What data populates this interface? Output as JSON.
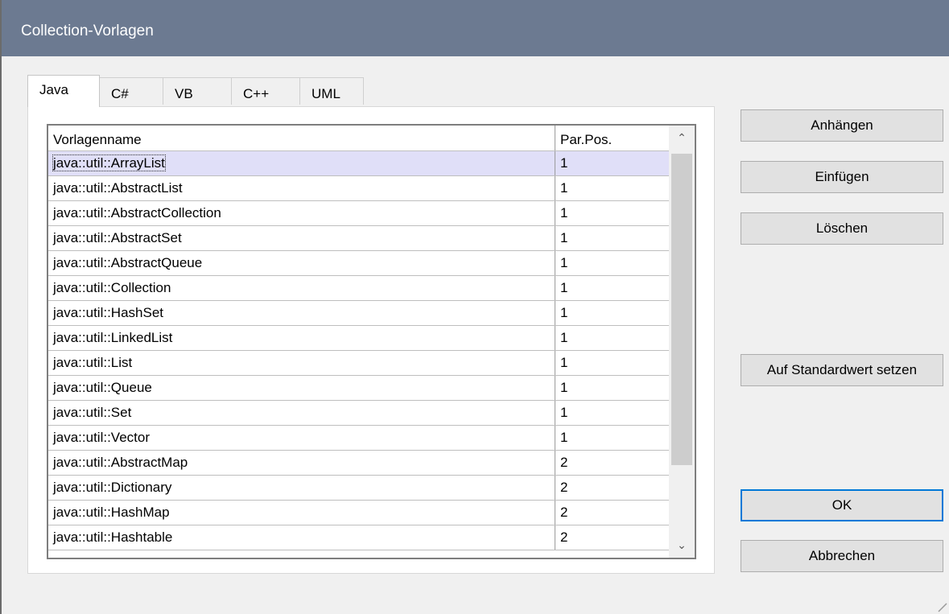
{
  "window": {
    "title": "Collection-Vorlagen"
  },
  "tabs": [
    {
      "label": "Java",
      "active": true
    },
    {
      "label": "C#",
      "active": false
    },
    {
      "label": "VB",
      "active": false
    },
    {
      "label": "C++",
      "active": false
    },
    {
      "label": "UML",
      "active": false
    }
  ],
  "table": {
    "columns": [
      "Vorlagenname",
      "Par.Pos."
    ],
    "rows": [
      {
        "name": "java::util::ArrayList",
        "pos": "1",
        "selected": true
      },
      {
        "name": "java::util::AbstractList",
        "pos": "1"
      },
      {
        "name": "java::util::AbstractCollection",
        "pos": "1"
      },
      {
        "name": "java::util::AbstractSet",
        "pos": "1"
      },
      {
        "name": "java::util::AbstractQueue",
        "pos": "1"
      },
      {
        "name": "java::util::Collection",
        "pos": "1"
      },
      {
        "name": "java::util::HashSet",
        "pos": "1"
      },
      {
        "name": "java::util::LinkedList",
        "pos": "1"
      },
      {
        "name": "java::util::List",
        "pos": "1"
      },
      {
        "name": "java::util::Queue",
        "pos": "1"
      },
      {
        "name": "java::util::Set",
        "pos": "1"
      },
      {
        "name": "java::util::Vector",
        "pos": "1"
      },
      {
        "name": "java::util::AbstractMap",
        "pos": "2"
      },
      {
        "name": "java::util::Dictionary",
        "pos": "2"
      },
      {
        "name": "java::util::HashMap",
        "pos": "2"
      },
      {
        "name": "java::util::Hashtable",
        "pos": "2"
      }
    ]
  },
  "scrollbar": {
    "up_glyph": "⌃",
    "down_glyph": "⌄"
  },
  "buttons": {
    "append": "Anhängen",
    "insert": "Einfügen",
    "delete": "Löschen",
    "reset": "Auf Standardwert setzen",
    "ok": "OK",
    "cancel": "Abbrechen"
  },
  "colors": {
    "titlebar": "#6c7a91",
    "selection": "#e0dff8",
    "default_button_border": "#0078d7"
  }
}
